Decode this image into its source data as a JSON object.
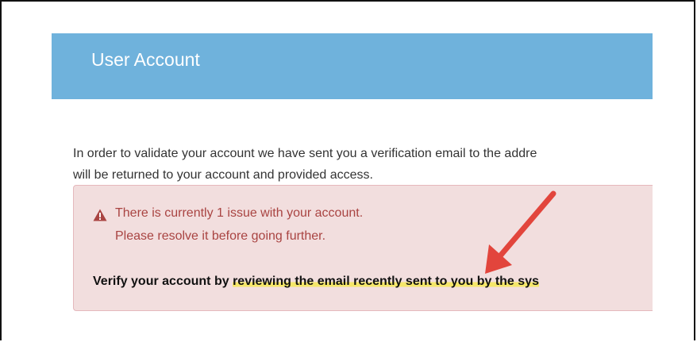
{
  "header": {
    "title": "User Account"
  },
  "intro": {
    "line1": "In order to validate your account we have sent you a verification email to the addre",
    "line2": "will be returned to your account and provided access."
  },
  "alert": {
    "icon": "warning-triangle-icon",
    "line1": "There is currently 1 issue with your account.",
    "line2": "Please resolve it before going further.",
    "verify_plain": "Verify your account by ",
    "verify_highlight": "reviewing the email recently sent to you by the sys"
  },
  "colors": {
    "header_bg": "#6fb2dc",
    "alert_bg": "#f2dede",
    "alert_text": "#a94442",
    "highlight": "#f5e76a",
    "arrow": "#e2453c"
  }
}
